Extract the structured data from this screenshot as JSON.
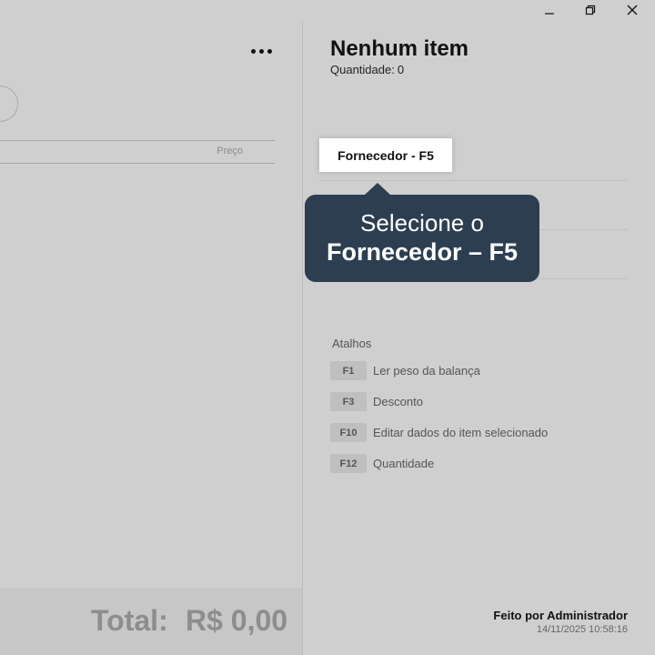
{
  "window": {
    "minimize_icon": "minimize-icon",
    "restore_icon": "restore-icon",
    "close_icon": "close-icon"
  },
  "left": {
    "more_icon": "more-horizontal-icon",
    "table_header": {
      "price": "Preço"
    },
    "total": {
      "label": "Total:",
      "value": "R$ 0,00"
    }
  },
  "cart": {
    "title": "Nenhum item",
    "quantity_label": "Quantidade:",
    "quantity_value": "0"
  },
  "supplier_button": {
    "label": "Fornecedor - F5"
  },
  "tooltip": {
    "line1": "Selecione o",
    "line2": "Fornecedor – F5"
  },
  "shortcuts": {
    "title": "Atalhos",
    "items": [
      {
        "key": "F1",
        "label": "Ler peso da balança"
      },
      {
        "key": "F3",
        "label": "Desconto"
      },
      {
        "key": "F10",
        "label": "Editar dados do item selecionado"
      },
      {
        "key": "F12",
        "label": "Quantidade"
      }
    ]
  },
  "footer": {
    "made_by": "Feito por Administrador",
    "timestamp": "14/11/2025 10:58:16"
  },
  "colors": {
    "overlay_bg": "#cfcfcf",
    "tooltip_bg": "#2d3e50",
    "button_bg": "#ffffff"
  }
}
